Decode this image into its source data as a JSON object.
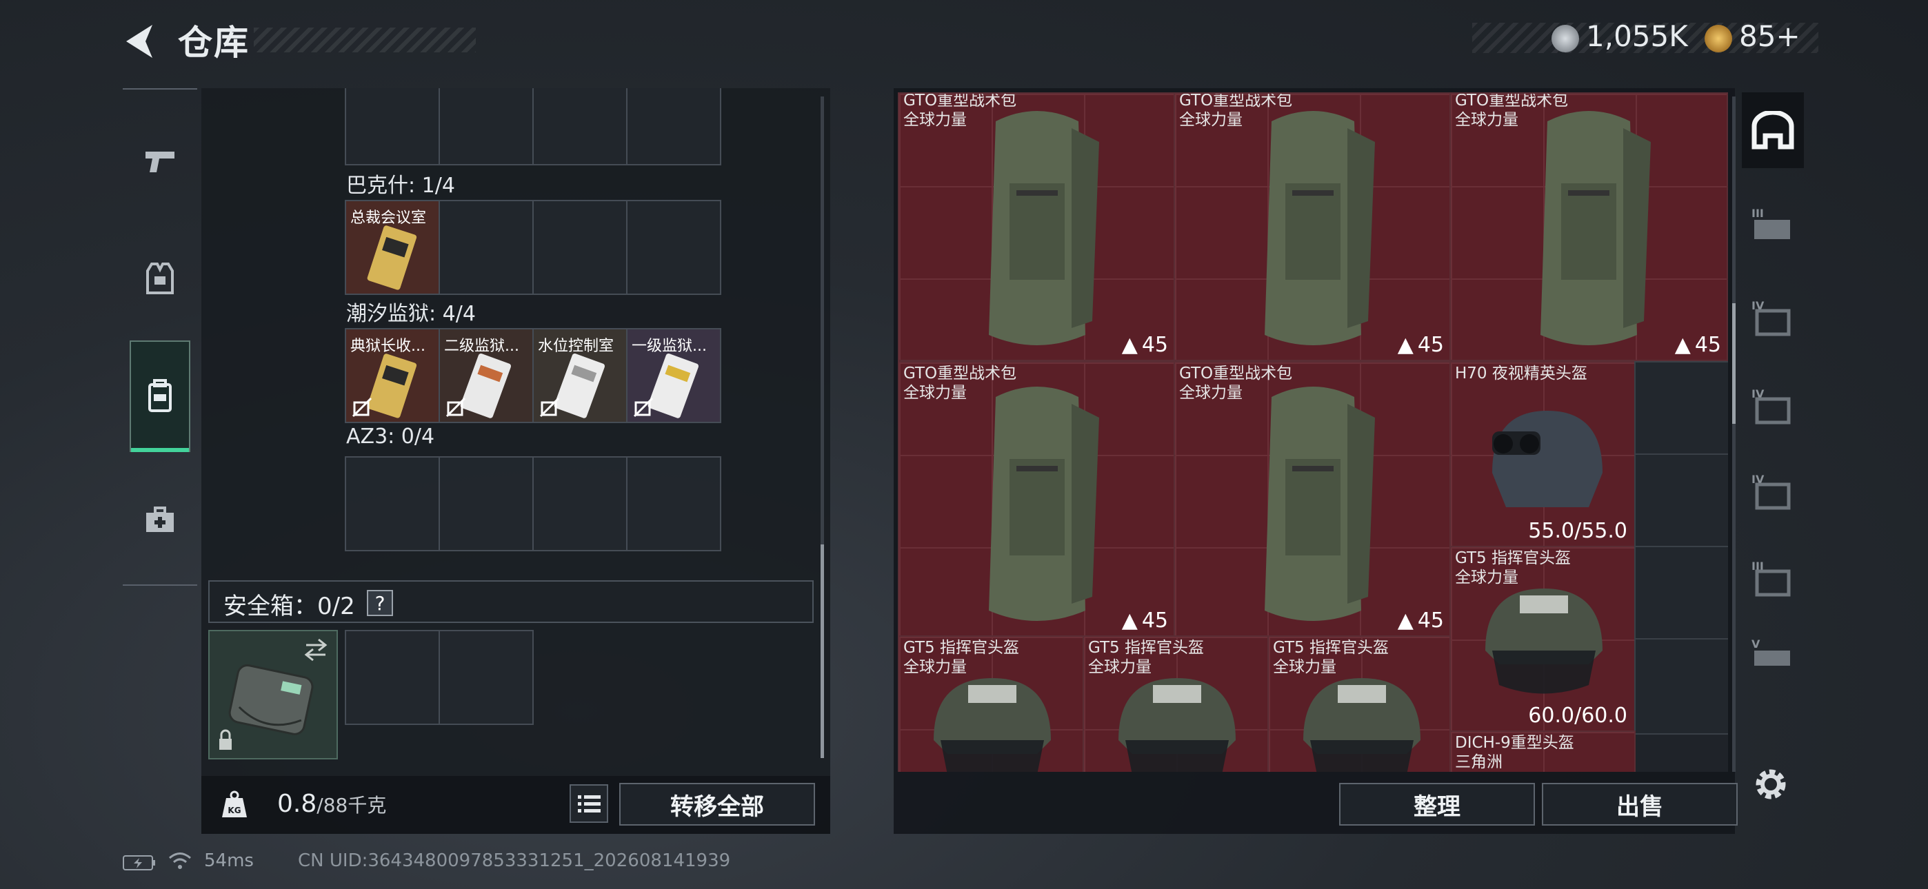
{
  "header": {
    "title": "仓库",
    "currency_coin": "1,055K",
    "currency_premium": "85+"
  },
  "left_tabs": [
    {
      "name": "weapons",
      "icon": "pistol-icon"
    },
    {
      "name": "equipment",
      "icon": "vest-icon"
    },
    {
      "name": "backpack",
      "icon": "backpack-icon",
      "selected": true
    },
    {
      "name": "medical",
      "icon": "medkit-icon"
    }
  ],
  "keys": {
    "bakeshi_label": "巴克什: 1/4",
    "bakeshi_items": [
      "总裁会议室"
    ],
    "prison_label": "潮汐监狱: 4/4",
    "prison_items": [
      "典狱长收...",
      "二级监狱...",
      "水位控制室",
      "一级监狱..."
    ],
    "az3_label": "AZ3: 0/4"
  },
  "safebox": {
    "label": "安全箱：0/2",
    "help": "?"
  },
  "bottom": {
    "weight_value": "0.8",
    "weight_max": "/88千克",
    "transfer_label": "转移全部"
  },
  "stash": {
    "items": [
      {
        "name": "GTO重型战术包",
        "sub": "全球力量",
        "capacity": "45"
      },
      {
        "name": "GTO重型战术包",
        "sub": "全球力量",
        "capacity": "45"
      },
      {
        "name": "GTO重型战术包",
        "sub": "全球力量",
        "capacity": "45"
      },
      {
        "name": "GTO重型战术包",
        "sub": "全球力量",
        "capacity": "45"
      },
      {
        "name": "GTO重型战术包",
        "sub": "全球力量",
        "capacity": "45"
      },
      {
        "name": "H70 夜视精英头盔",
        "sub": "",
        "durability": "55.0/55.0"
      },
      {
        "name": "GT5 指挥官头盔",
        "sub": "全球力量",
        "durability": "60.0/60.0"
      },
      {
        "name": "GT5 指挥官头盔",
        "sub": "全球力量"
      },
      {
        "name": "GT5 指挥官头盔",
        "sub": "全球力量"
      },
      {
        "name": "GT5 指挥官头盔",
        "sub": "全球力量"
      },
      {
        "name": "DICH-9重型头盔",
        "sub": "三角洲"
      }
    ],
    "sort_label": "整理",
    "sell_label": "出售"
  },
  "right_filters": [
    "all-icon",
    "III-rig-icon",
    "IV-armor-icon",
    "IV-armor-icon",
    "IV-armor-icon",
    "III-armor-icon",
    "V-rig-icon"
  ],
  "status": {
    "ping": "54ms",
    "uid": "CN UID:3643480097853331251_202608141939"
  },
  "colors": {
    "accent_green": "#43d39b",
    "item_red": "#5a1f27",
    "panel_bg": "#181c21"
  }
}
